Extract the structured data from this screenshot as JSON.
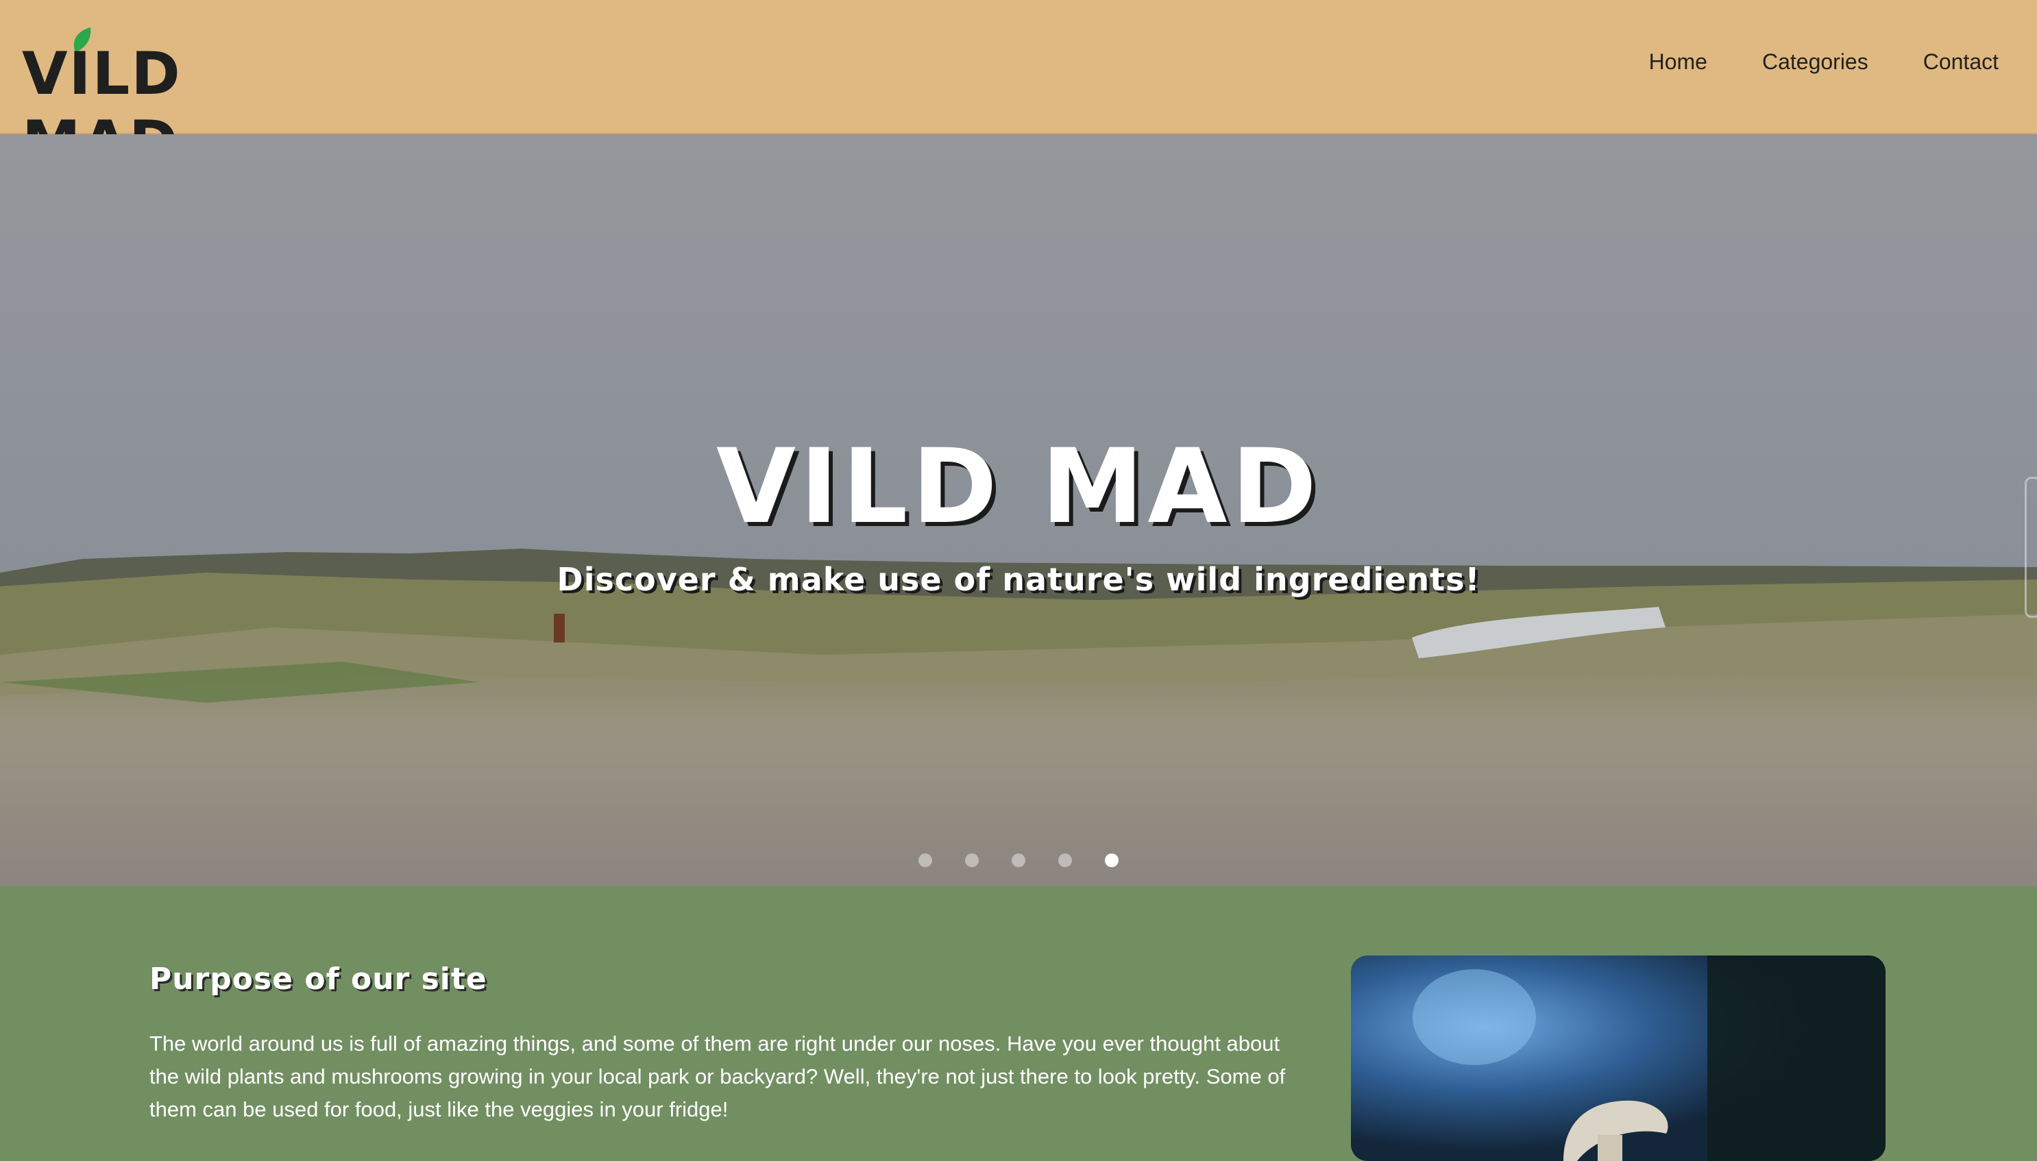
{
  "header": {
    "logo_text": "VILD MAD",
    "nav": [
      "Home",
      "Categories",
      "Contact"
    ]
  },
  "hero": {
    "title": "VILD MAD",
    "subtitle": "Discover & make use of nature's wild ingredients!",
    "slide_count": 5,
    "active_slide": 4
  },
  "purpose": {
    "title": "Purpose of our site",
    "text": "The world around us is full of amazing things, and some of them are right under our noses. Have you ever thought about the wild plants and mushrooms growing in your local park or backyard? Well, they're not just there to look pretty. Some of them can be used for food, just like the veggies in your fridge!"
  },
  "colors": {
    "header_bg": "#dfb981",
    "section_bg": "#728f62",
    "leaf": "#2aa84a"
  },
  "icons": [
    "leaf-icon"
  ]
}
